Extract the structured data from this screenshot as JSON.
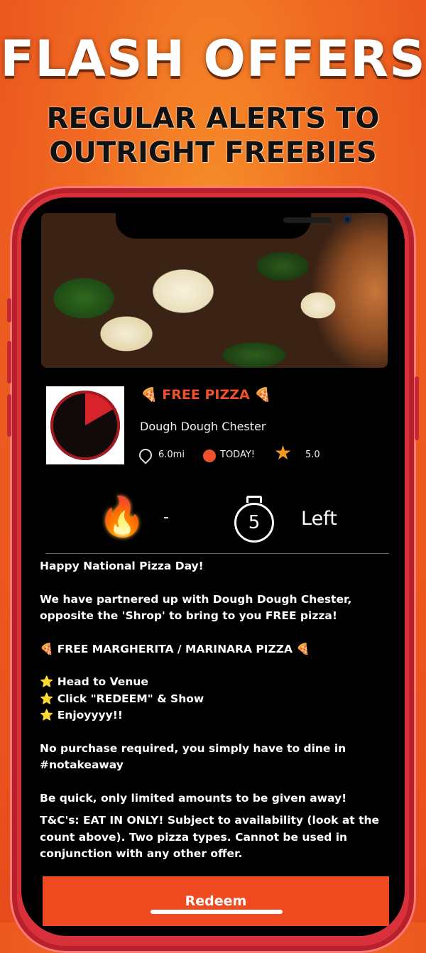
{
  "promo": {
    "headline": "FLASH OFFERS",
    "subheadline": "REGULAR ALERTS TO\nOUTRIGHT FREEBIES"
  },
  "offer": {
    "title": "🍕 FREE PIZZA 🍕",
    "venue": "Dough Dough Chester",
    "distance": "6.0mi",
    "availability": "TODAY!",
    "rating": "5.0",
    "claimed": "-",
    "remaining_count": "5",
    "remaining_label": "Left",
    "description": [
      "Happy National Pizza Day!",
      "We have partnered up with Dough Dough Chester, opposite the 'Shrop' to bring to you FREE pizza!",
      "🍕 FREE MARGHERITA / MARINARA PIZZA 🍕",
      "⭐ Head to Venue\n⭐ Click \"REDEEM\" & Show\n⭐ Enjoyyyy!!",
      "No purchase required, you simply have to dine in #notakeaway",
      "Be quick, only limited amounts to be given away!",
      "T&C's: EAT IN ONLY! Subject to availability (look at the count above). Two pizza types. Cannot be used in conjunction with any other offer."
    ],
    "redeem_label": "Redeem"
  },
  "icons": {
    "flame": "flame-icon",
    "timer": "stopwatch-icon",
    "distance": "location-pin-icon",
    "availability": "dot-icon",
    "rating": "star-icon"
  },
  "colors": {
    "accent": "#ef4a20",
    "background_top": "#f7922a",
    "phone_frame": "#d9313b",
    "star": "#f59a1c"
  }
}
